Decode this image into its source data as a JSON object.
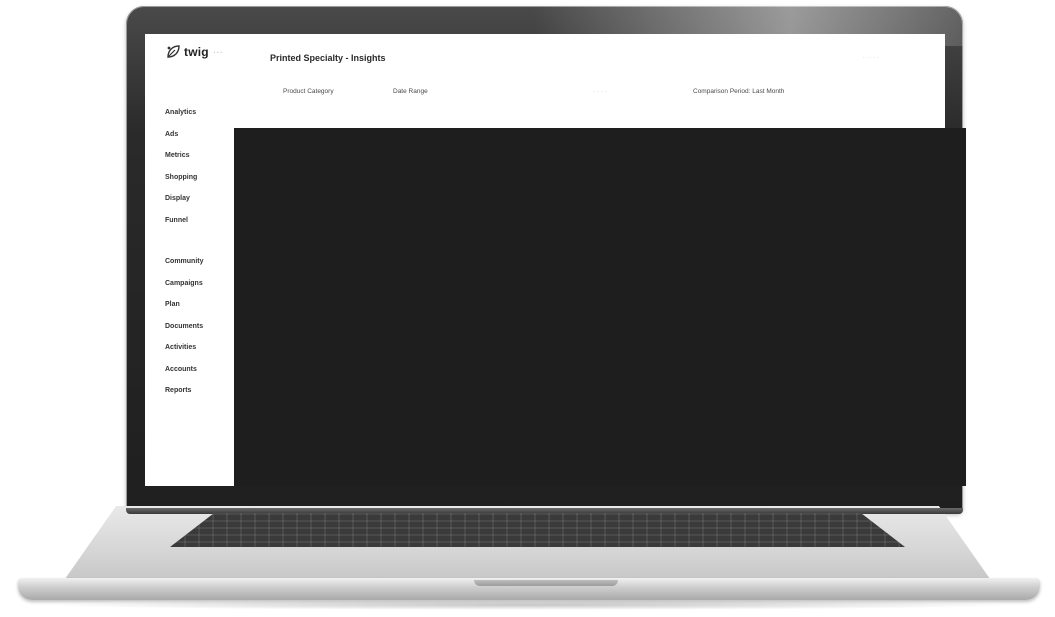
{
  "app": {
    "logo_text": "twig",
    "logo_suffix": "···",
    "logo_icon": "leaf-icon"
  },
  "header": {
    "title": "Printed Specialty - Insights",
    "right_text": "· · · · ·"
  },
  "filters": [
    {
      "label": "Product Category"
    },
    {
      "label": "Date Range"
    },
    {
      "label": "· · · ·"
    },
    {
      "label": "Comparison Period: Last Month"
    }
  ],
  "sidebar": {
    "items_top": [
      {
        "label": "Analytics"
      },
      {
        "label": "Ads"
      },
      {
        "label": "Metrics"
      },
      {
        "label": "Shopping"
      },
      {
        "label": "Display"
      },
      {
        "label": "Funnel"
      }
    ],
    "items_bottom": [
      {
        "label": "Community"
      },
      {
        "label": "Campaigns"
      },
      {
        "label": "Plan"
      },
      {
        "label": "Documents"
      },
      {
        "label": "Activities"
      },
      {
        "label": "Accounts"
      },
      {
        "label": "Reports"
      }
    ]
  },
  "colors": {
    "bezel": "#1f1f1f",
    "screen_bg": "#ffffff",
    "overlay_panel": "#1e1e1e",
    "chassis": "#d6d6d6"
  }
}
